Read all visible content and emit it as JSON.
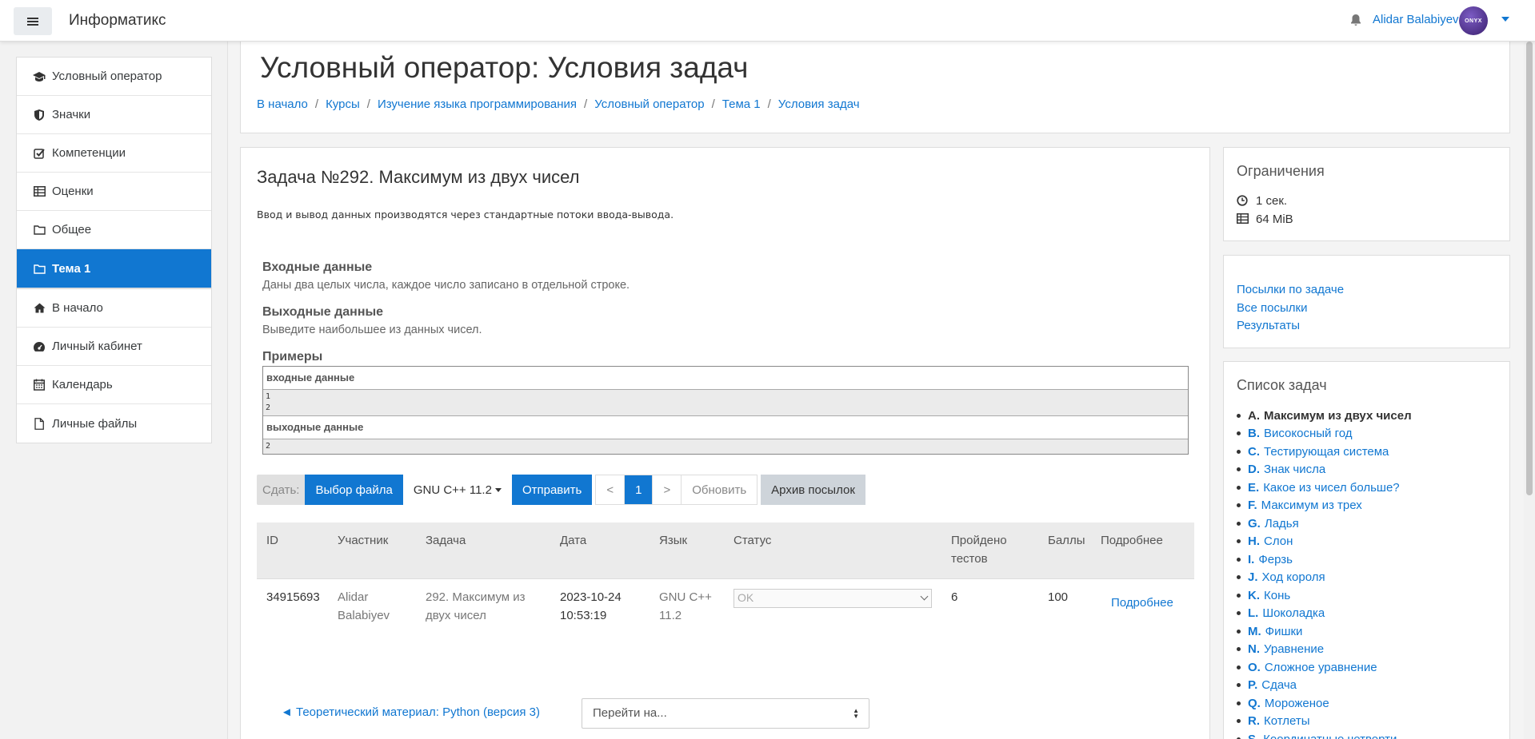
{
  "navbar": {
    "site_name": "Информатикс",
    "user_name": "Alidar Balabiyev",
    "avatar_text": "ONYX"
  },
  "drawer": {
    "course_items": [
      {
        "label": "Условный оператор",
        "icon": "graduation-cap-icon"
      },
      {
        "label": "Значки",
        "icon": "shield-icon"
      },
      {
        "label": "Компетенции",
        "icon": "check-square-icon"
      },
      {
        "label": "Оценки",
        "icon": "table-icon"
      },
      {
        "label": "Общее",
        "icon": "folder-icon"
      },
      {
        "label": "Тема 1",
        "icon": "folder-icon",
        "active": true
      }
    ],
    "site_items": [
      {
        "label": "В начало",
        "icon": "home-icon"
      },
      {
        "label": "Личный кабинет",
        "icon": "dashboard-icon"
      },
      {
        "label": "Календарь",
        "icon": "calendar-icon"
      },
      {
        "label": "Личные файлы",
        "icon": "file-icon"
      }
    ]
  },
  "header": {
    "title": "Условный оператор: Условия задач",
    "breadcrumb": [
      "В начало",
      "Курсы",
      "Изучение языка программирования",
      "Условный оператор",
      "Тема 1",
      "Условия задач"
    ]
  },
  "task": {
    "title": "Задача №292. Максимум из двух чисел",
    "io_note": "Ввод и вывод данных производятся через стандартные потоки ввода-вывода.",
    "input_heading": "Входные данные",
    "input_text": "Даны два целых числа, каждое число записано в отдельной строке.",
    "output_heading": "Выходные данные",
    "output_text": "Выведите наибольшее из данных чисел.",
    "examples_heading": "Примеры",
    "example_input_label": "входные данные",
    "example_input_lines": [
      "1",
      "2"
    ],
    "example_output_label": "выходные данные",
    "example_output_lines": [
      "2"
    ]
  },
  "submit_bar": {
    "label": "Сдать:",
    "choose_file": "Выбор файла",
    "language": "GNU C++ 11.2",
    "send": "Отправить",
    "prev": "<",
    "page": "1",
    "next": ">",
    "refresh": "Обновить",
    "archive": "Архив посылок"
  },
  "submissions": {
    "headers": {
      "id": "ID",
      "participant": "Участник",
      "task": "Задача",
      "date": "Дата",
      "lang": "Язык",
      "status": "Статус",
      "passed": "Пройдено тестов",
      "score": "Баллы",
      "details": "Подробнее"
    },
    "rows": [
      {
        "id": "34915693",
        "participant": "Alidar Balabiyev",
        "task": "292. Максимум из двух чисел",
        "date": "2023-10-24 10:53:19",
        "lang": "GNU C++ 11.2",
        "status": "OK",
        "passed": "6",
        "score": "100",
        "details": "Подробнее"
      }
    ]
  },
  "footer_nav": {
    "prev_link": "◄ Теоретический материал: Python (версия 3)",
    "jump_placeholder": "Перейти на..."
  },
  "limits": {
    "title": "Ограничения",
    "time": "1 сек.",
    "memory": "64 MiB"
  },
  "links": {
    "by_task": "Посылки по задаче",
    "all": "Все посылки",
    "results": "Результаты"
  },
  "problems": {
    "title": "Список задач",
    "items": [
      {
        "letter": "A.",
        "name": "Максимум из двух чисел",
        "current": true
      },
      {
        "letter": "B.",
        "name": "Високосный год"
      },
      {
        "letter": "C.",
        "name": "Тестирующая система"
      },
      {
        "letter": "D.",
        "name": "Знак числа"
      },
      {
        "letter": "E.",
        "name": "Какое из чисел больше?"
      },
      {
        "letter": "F.",
        "name": "Максимум из трех"
      },
      {
        "letter": "G.",
        "name": "Ладья"
      },
      {
        "letter": "H.",
        "name": "Слон"
      },
      {
        "letter": "I.",
        "name": "Ферзь"
      },
      {
        "letter": "J.",
        "name": "Ход короля"
      },
      {
        "letter": "K.",
        "name": "Конь"
      },
      {
        "letter": "L.",
        "name": "Шоколадка"
      },
      {
        "letter": "M.",
        "name": "Фишки"
      },
      {
        "letter": "N.",
        "name": "Уравнение"
      },
      {
        "letter": "O.",
        "name": "Сложное уравнение"
      },
      {
        "letter": "P.",
        "name": "Сдача"
      },
      {
        "letter": "Q.",
        "name": "Мороженое"
      },
      {
        "letter": "R.",
        "name": "Котлеты"
      },
      {
        "letter": "S.",
        "name": "Координатные четверти"
      }
    ]
  },
  "colors": {
    "accent": "#1177d1",
    "active_nav_bg": "#1177d1"
  }
}
